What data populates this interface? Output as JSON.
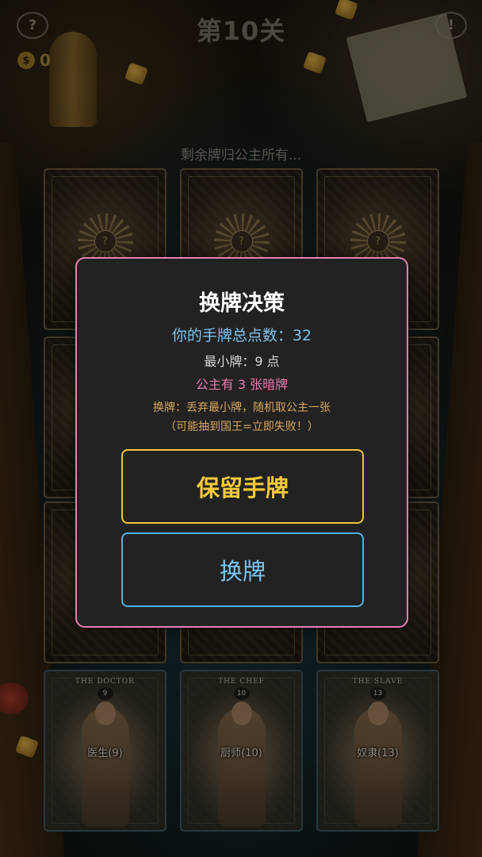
{
  "header": {
    "help_label": "?",
    "level_title": "第10关",
    "alert_label": "!",
    "coins": "0",
    "coin_symbol": "$"
  },
  "status_text": "剩余牌归公主所有...",
  "board": {
    "hidden_card_values": [
      "?",
      "?",
      "?"
    ],
    "player_cards": [
      {
        "title": "THE DOCTOR",
        "number": "9",
        "label": "医生(9)"
      },
      {
        "title": "THE CHEF",
        "number": "10",
        "label": "厨师(10)"
      },
      {
        "title": "THE SLAVE",
        "number": "13",
        "label": "奴隶(13)"
      }
    ]
  },
  "modal": {
    "title": "换牌决策",
    "total_points": "你的手牌总点数：32",
    "min_card": "最小牌：9 点",
    "princess_hidden": "公主有 3 张暗牌",
    "rule_line1": "换牌：丢弃最小牌，随机取公主一张",
    "rule_line2": "（可能抽到国王=立即失败！）",
    "keep_button": "保留手牌",
    "swap_button": "换牌"
  },
  "colors": {
    "modal_border": "#e77fb0",
    "keep_accent": "#f0c43a",
    "swap_accent": "#4fb2e6",
    "total_text": "#7cc2ec",
    "rule_text": "#d9a75d"
  }
}
